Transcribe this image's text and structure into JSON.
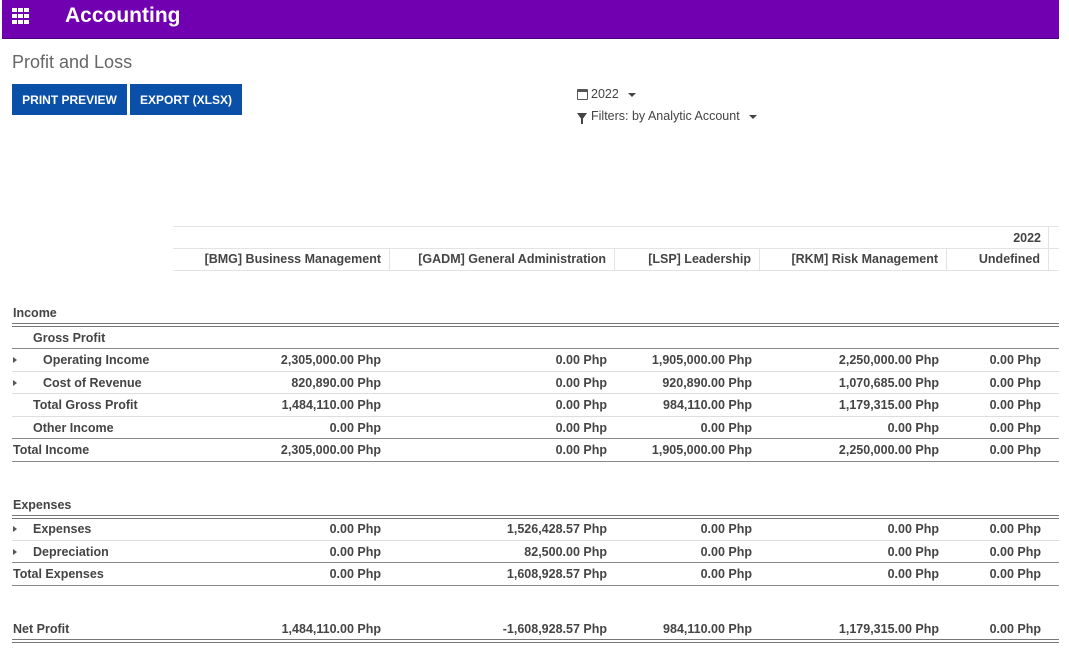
{
  "header": {
    "app_title": "Accounting",
    "apps_icon": "apps-grid-icon"
  },
  "breadcrumb": {
    "title": "Profit and Loss"
  },
  "toolbar": {
    "print_label": "PRINT PREVIEW",
    "export_label": "EXPORT (XLSX)"
  },
  "filters": {
    "year_label": "2022",
    "year_icon": "calendar-icon",
    "analytic_label": "Filters: by Analytic Account",
    "analytic_icon": "funnel-icon"
  },
  "table": {
    "period": "2022",
    "columns": [
      "[BMG] Business Management",
      "[GADM] General Administration",
      "[LSP] Leadership",
      "[RKM] Risk Management",
      "Undefined"
    ],
    "sections": {
      "income": "Income",
      "gross_profit": "Gross Profit",
      "expenses": "Expenses"
    },
    "rows": {
      "operating_income": {
        "label": "Operating Income",
        "values": [
          "2,305,000.00 Php",
          "0.00 Php",
          "1,905,000.00 Php",
          "2,250,000.00 Php",
          "0.00 Php"
        ]
      },
      "cost_of_revenue": {
        "label": "Cost of Revenue",
        "values": [
          "820,890.00 Php",
          "0.00 Php",
          "920,890.00 Php",
          "1,070,685.00 Php",
          "0.00 Php"
        ]
      },
      "total_gross_profit": {
        "label": "Total Gross Profit",
        "values": [
          "1,484,110.00 Php",
          "0.00 Php",
          "984,110.00 Php",
          "1,179,315.00 Php",
          "0.00 Php"
        ]
      },
      "other_income": {
        "label": "Other Income",
        "values": [
          "0.00 Php",
          "0.00 Php",
          "0.00 Php",
          "0.00 Php",
          "0.00 Php"
        ]
      },
      "total_income": {
        "label": "Total Income",
        "values": [
          "2,305,000.00 Php",
          "0.00 Php",
          "1,905,000.00 Php",
          "2,250,000.00 Php",
          "0.00 Php"
        ]
      },
      "expenses": {
        "label": "Expenses",
        "values": [
          "0.00 Php",
          "1,526,428.57 Php",
          "0.00 Php",
          "0.00 Php",
          "0.00 Php"
        ]
      },
      "depreciation": {
        "label": "Depreciation",
        "values": [
          "0.00 Php",
          "82,500.00 Php",
          "0.00 Php",
          "0.00 Php",
          "0.00 Php"
        ]
      },
      "total_expenses": {
        "label": "Total Expenses",
        "values": [
          "0.00 Php",
          "1,608,928.57 Php",
          "0.00 Php",
          "0.00 Php",
          "0.00 Php"
        ]
      },
      "net_profit": {
        "label": "Net Profit",
        "values": [
          "1,484,110.00 Php",
          "-1,608,928.57 Php",
          "984,110.00 Php",
          "1,179,315.00 Php",
          "0.00 Php"
        ]
      }
    }
  }
}
